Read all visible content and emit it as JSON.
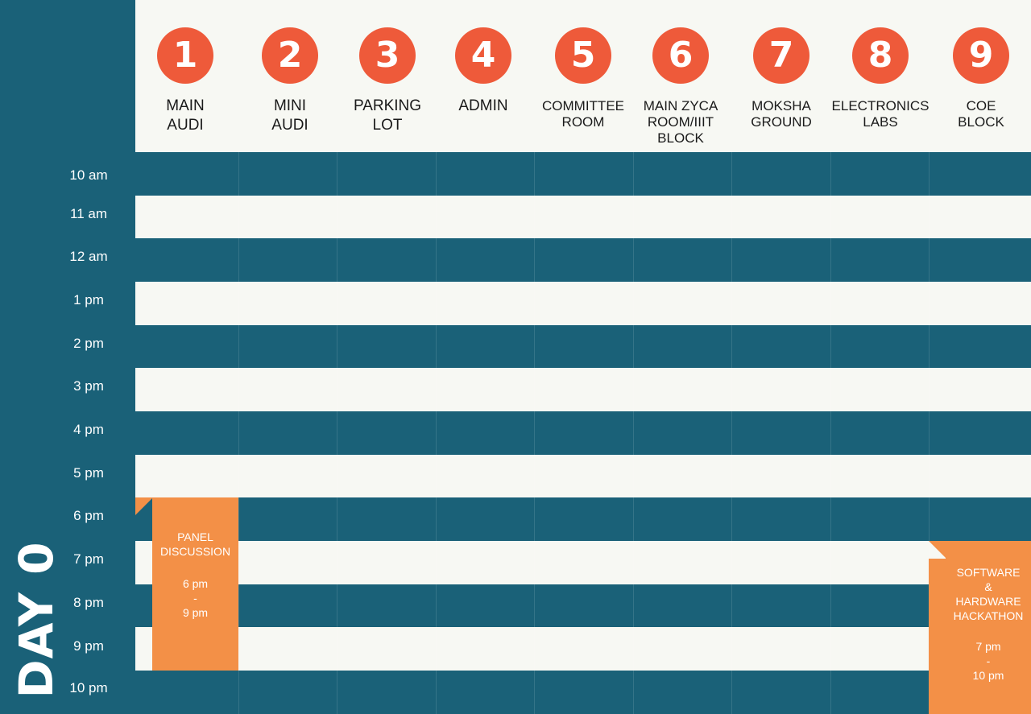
{
  "day_label": "DAY 0",
  "venues": [
    {
      "num": "1",
      "name": "MAIN\nAUDI"
    },
    {
      "num": "2",
      "name": "MINI\nAUDI"
    },
    {
      "num": "3",
      "name": "PARKING\nLOT"
    },
    {
      "num": "4",
      "name": "ADMIN"
    },
    {
      "num": "5",
      "name": "COMMITTEE\nROOM"
    },
    {
      "num": "6",
      "name": "MAIN ZYCA\nROOM/IIIT\nBLOCK"
    },
    {
      "num": "7",
      "name": "MOKSHA\nGROUND"
    },
    {
      "num": "8",
      "name": "ELECTRONICS\nLABS"
    },
    {
      "num": "9",
      "name": "COE\nBLOCK"
    }
  ],
  "times": [
    "10 am",
    "11 am",
    "12 am",
    "1 pm",
    "2 pm",
    "3 pm",
    "4 pm",
    "5 pm",
    "6 pm",
    "7 pm",
    "8 pm",
    "9 pm",
    "10 pm"
  ],
  "events": [
    {
      "title": "PANEL\nDISCUSSION",
      "start": "6 pm",
      "sep": "-",
      "end": "9 pm"
    },
    {
      "title": "SOFTWARE\n&\nHARDWARE\nHACKATHON",
      "start": "7 pm",
      "sep": "-",
      "end": "10 pm"
    }
  ],
  "colors": {
    "teal": "#1a6178",
    "orange": "#f39047",
    "badge_red": "#ee5a3a",
    "cream": "#f7f8f3"
  }
}
